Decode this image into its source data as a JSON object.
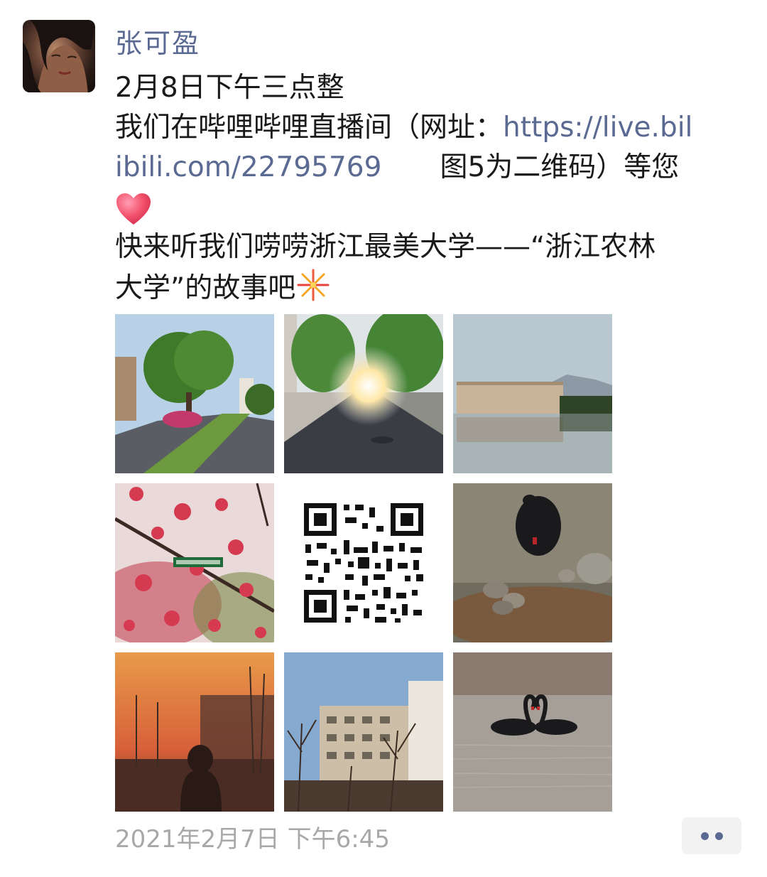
{
  "post": {
    "author": "张可盈",
    "lines": {
      "l1": "2月8日下午三点整",
      "l2_text": "我们在哔哩哔哩直播间（网址：",
      "l2_link": "https://live.bil",
      "l3_link": "ibili.com/22795769",
      "l3_text": "图5为二维码）等您",
      "l5": "快来听我们唠唠浙江最美大学——“浙江农林",
      "l6": "大学”的故事吧"
    },
    "timestamp": "2021年2月7日 下午6:45"
  },
  "icons": {
    "heart": "red-heart-emoji",
    "fireworks": "fireworks-emoji",
    "more": "more-dots-icon"
  },
  "colors": {
    "name": "#5b6a92",
    "link": "#5b6a92",
    "timestamp": "#a8a8a8"
  }
}
